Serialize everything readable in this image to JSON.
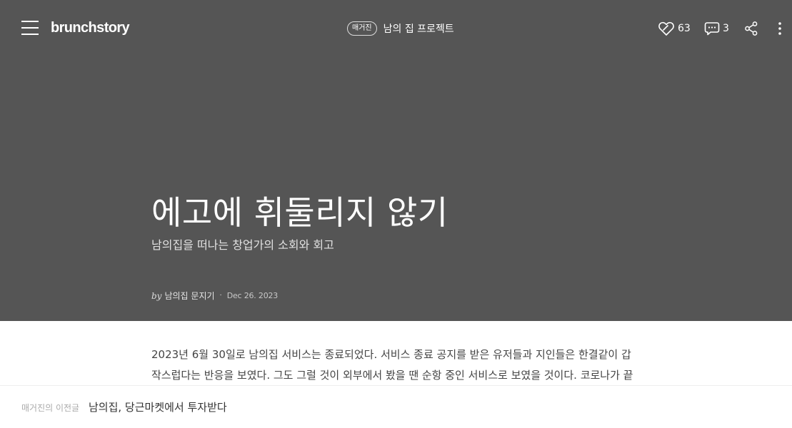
{
  "header": {
    "logo": "brunchstory",
    "magazine_badge": "매거진",
    "magazine_title": "남의 집 프로젝트",
    "like_count": "63",
    "comment_count": "3"
  },
  "cover": {
    "title": "에고에 휘둘리지 않기",
    "subtitle": "남의집을 떠나는 창업가의 소회와 회고",
    "by": "by",
    "author": "남의집 문지기",
    "separator": "·",
    "date": "Dec 26. 2023",
    "background_color": "#555555"
  },
  "article": {
    "lines": [
      "2023년 6월 30일로 남의집 서비스는 종료되었다. 서비스 종료 공지를 받은 유저들과 지인들은 한결같이 갑",
      "작스럽다는 반응을 보였다. 그도 그럴 것이 외부에서 봤을 땐 순항 중인 서비스로 보였을 것이다. 코로나가 끝"
    ]
  },
  "bottom_bar": {
    "prev_label": "매거진의 이전글",
    "prev_title": "남의집, 당근마켓에서 투자받다"
  },
  "icons": {
    "menu": "hamburger-menu-icon",
    "like": "heart-icon",
    "comment": "speech-bubble-icon",
    "share": "share-icon",
    "more": "more-vertical-icon"
  }
}
